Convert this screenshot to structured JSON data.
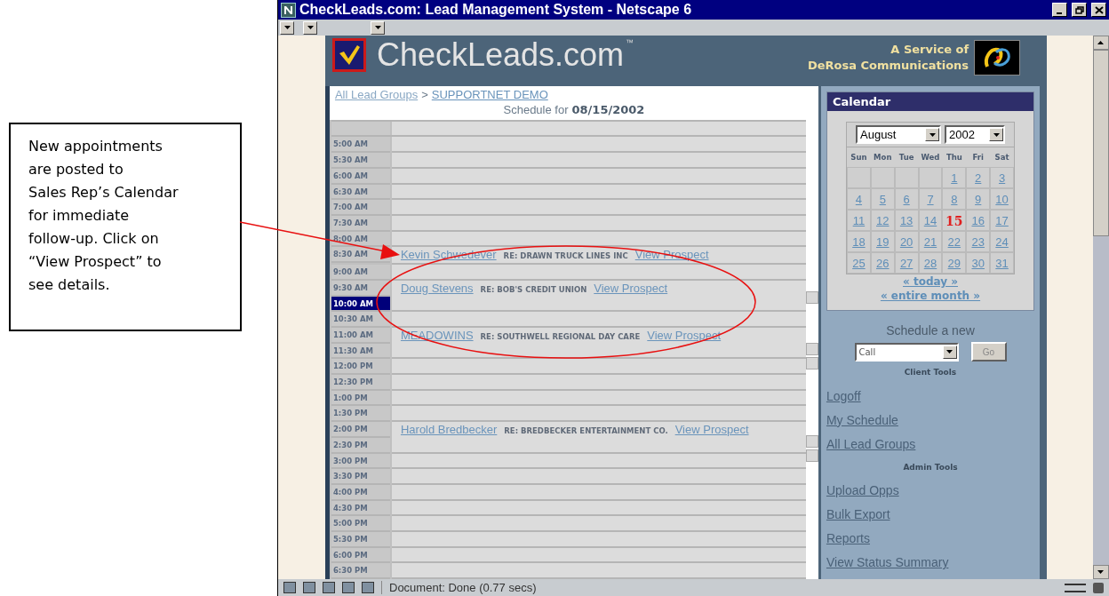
{
  "callout": {
    "text": "New appointments\nare posted to\nSales Rep’s Calendar\nfor immediate\nfollow-up. Click on\n“View Prospect” to\nsee details."
  },
  "window": {
    "title": "CheckLeads.com: Lead Management System - Netscape 6"
  },
  "header": {
    "logo": "CheckLeads.com",
    "trademark": "™",
    "service_line_1": "A Service of",
    "service_line_2": "DeRosa Communications"
  },
  "breadcrumb": {
    "root": "All Lead Groups",
    "separator": ">",
    "current": "SUPPORTNET DEMO"
  },
  "schedule": {
    "label": "Schedule for",
    "date": "08/15/2002",
    "blocks": [
      {
        "times": [
          {
            "label": "5:00 AM",
            "selected": false
          }
        ]
      },
      {
        "times": [
          {
            "label": "5:30 AM",
            "selected": false
          }
        ]
      },
      {
        "times": [
          {
            "label": "6:00 AM",
            "selected": false
          }
        ]
      },
      {
        "times": [
          {
            "label": "6:30 AM",
            "selected": false
          }
        ]
      },
      {
        "times": [
          {
            "label": "7:00 AM",
            "selected": false
          }
        ]
      },
      {
        "times": [
          {
            "label": "7:30 AM",
            "selected": false
          }
        ]
      },
      {
        "times": [
          {
            "label": "8:00 AM",
            "selected": false
          }
        ]
      },
      {
        "times": [
          {
            "label": "8:30 AM",
            "selected": false
          }
        ],
        "appointment": {
          "name": "Kevin Schwedever",
          "re": "RE: DRAWN TRUCK LINES INC",
          "link": "View Prospect"
        }
      },
      {
        "times": [
          {
            "label": "9:00 AM",
            "selected": false
          }
        ]
      },
      {
        "times": [
          {
            "label": "9:30 AM",
            "selected": false
          },
          {
            "label": "10:00 AM",
            "selected": true
          }
        ],
        "appointment": {
          "name": "Doug Stevens",
          "re": "RE: BOB'S CREDIT UNION",
          "link": "View Prospect"
        }
      },
      {
        "times": [
          {
            "label": "10:30 AM",
            "selected": false
          }
        ]
      },
      {
        "times": [
          {
            "label": "11:00 AM",
            "selected": false
          },
          {
            "label": "11:30 AM",
            "selected": false
          }
        ],
        "appointment": {
          "name": "MEADOWINS",
          "re": "RE: SOUTHWELL REGIONAL DAY CARE",
          "link": "View Prospect"
        }
      },
      {
        "times": [
          {
            "label": "12:00 PM",
            "selected": false
          }
        ]
      },
      {
        "times": [
          {
            "label": "12:30 PM",
            "selected": false
          }
        ]
      },
      {
        "times": [
          {
            "label": "1:00 PM",
            "selected": false
          }
        ]
      },
      {
        "times": [
          {
            "label": "1:30 PM",
            "selected": false
          }
        ]
      },
      {
        "times": [
          {
            "label": "2:00 PM",
            "selected": false
          },
          {
            "label": "2:30 PM",
            "selected": false
          }
        ],
        "appointment": {
          "name": "Harold Bredbecker",
          "re": "RE: BREDBECKER ENTERTAINMENT CO.",
          "link": "View Prospect"
        }
      },
      {
        "times": [
          {
            "label": "3:00 PM",
            "selected": false
          }
        ]
      },
      {
        "times": [
          {
            "label": "3:30 PM",
            "selected": false
          }
        ]
      },
      {
        "times": [
          {
            "label": "4:00 PM",
            "selected": false
          }
        ]
      },
      {
        "times": [
          {
            "label": "4:30 PM",
            "selected": false
          }
        ]
      },
      {
        "times": [
          {
            "label": "5:00 PM",
            "selected": false
          }
        ]
      },
      {
        "times": [
          {
            "label": "5:30 PM",
            "selected": false
          }
        ]
      },
      {
        "times": [
          {
            "label": "6:00 PM",
            "selected": false
          }
        ]
      },
      {
        "times": [
          {
            "label": "6:30 PM",
            "selected": false
          }
        ]
      }
    ]
  },
  "calendar": {
    "title": "Calendar",
    "month": "August",
    "year": "2002",
    "weekdays": [
      "Sun",
      "Mon",
      "Tue",
      "Wed",
      "Thu",
      "Fri",
      "Sat"
    ],
    "weeks": [
      [
        {
          "kind": "empty"
        },
        {
          "kind": "empty"
        },
        {
          "kind": "empty"
        },
        {
          "kind": "empty"
        },
        {
          "kind": "day",
          "label": "1",
          "selected": false
        },
        {
          "kind": "day",
          "label": "2",
          "selected": false
        },
        {
          "kind": "day",
          "label": "3",
          "selected": false
        }
      ],
      [
        {
          "kind": "day",
          "label": "4",
          "selected": false
        },
        {
          "kind": "day",
          "label": "5",
          "selected": false
        },
        {
          "kind": "day",
          "label": "6",
          "selected": false
        },
        {
          "kind": "day",
          "label": "7",
          "selected": false
        },
        {
          "kind": "day",
          "label": "8",
          "selected": false
        },
        {
          "kind": "day",
          "label": "9",
          "selected": false
        },
        {
          "kind": "day",
          "label": "10",
          "selected": false
        }
      ],
      [
        {
          "kind": "day",
          "label": "11",
          "selected": false
        },
        {
          "kind": "day",
          "label": "12",
          "selected": false
        },
        {
          "kind": "day",
          "label": "13",
          "selected": false
        },
        {
          "kind": "day",
          "label": "14",
          "selected": false
        },
        {
          "kind": "day",
          "label": "15",
          "selected": true
        },
        {
          "kind": "day",
          "label": "16",
          "selected": false
        },
        {
          "kind": "day",
          "label": "17",
          "selected": false
        }
      ],
      [
        {
          "kind": "day",
          "label": "18",
          "selected": false
        },
        {
          "kind": "day",
          "label": "19",
          "selected": false
        },
        {
          "kind": "day",
          "label": "20",
          "selected": false
        },
        {
          "kind": "day",
          "label": "21",
          "selected": false
        },
        {
          "kind": "day",
          "label": "22",
          "selected": false
        },
        {
          "kind": "day",
          "label": "23",
          "selected": false
        },
        {
          "kind": "day",
          "label": "24",
          "selected": false
        }
      ],
      [
        {
          "kind": "day",
          "label": "25",
          "selected": false
        },
        {
          "kind": "day",
          "label": "26",
          "selected": false
        },
        {
          "kind": "day",
          "label": "27",
          "selected": false
        },
        {
          "kind": "day",
          "label": "28",
          "selected": false
        },
        {
          "kind": "day",
          "label": "29",
          "selected": false
        },
        {
          "kind": "day",
          "label": "30",
          "selected": false
        },
        {
          "kind": "day",
          "label": "31",
          "selected": false
        }
      ]
    ],
    "links": [
      "« today »",
      "« entire month »"
    ]
  },
  "new_item": {
    "label": "Schedule a new",
    "value": "Call",
    "button": "Go"
  },
  "tool_groups": [
    {
      "heading": "Client Tools",
      "links": [
        "Logoff",
        "My Schedule",
        "All Lead Groups"
      ]
    },
    {
      "heading": "Admin Tools",
      "links": [
        "Upload Opps",
        "Bulk Export",
        "Reports",
        "View Status Summary"
      ]
    }
  ],
  "status_bar": {
    "text": "Document: Done (0.77 secs)"
  }
}
